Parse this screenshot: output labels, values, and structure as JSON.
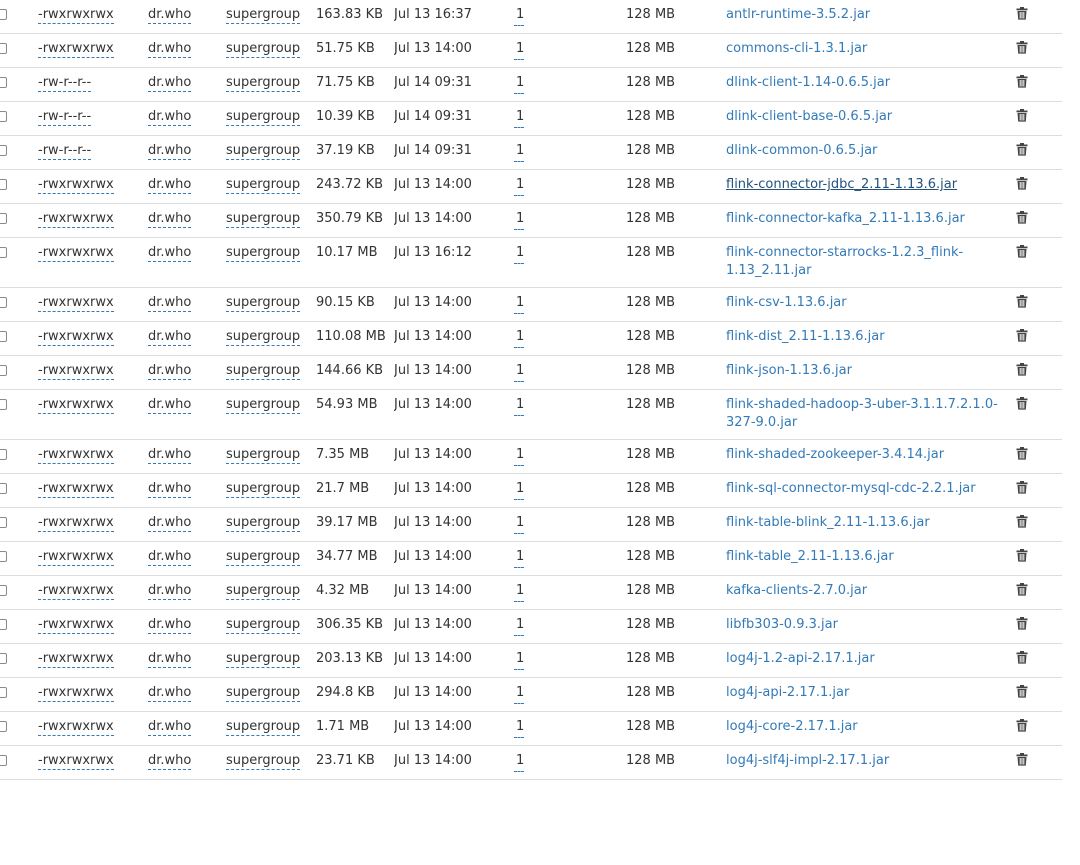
{
  "files": [
    {
      "permission": "-rwxrwxrwx",
      "owner": "dr.who",
      "group": "supergroup",
      "size": "163.83 KB",
      "last_modified": "Jul 13 16:37",
      "replication": "1",
      "block_size": "128 MB",
      "name": "antlr-runtime-3.5.2.jar"
    },
    {
      "permission": "-rwxrwxrwx",
      "owner": "dr.who",
      "group": "supergroup",
      "size": "51.75 KB",
      "last_modified": "Jul 13 14:00",
      "replication": "1",
      "block_size": "128 MB",
      "name": "commons-cli-1.3.1.jar"
    },
    {
      "permission": "-rw-r--r--",
      "owner": "dr.who",
      "group": "supergroup",
      "size": "71.75 KB",
      "last_modified": "Jul 14 09:31",
      "replication": "1",
      "block_size": "128 MB",
      "name": "dlink-client-1.14-0.6.5.jar"
    },
    {
      "permission": "-rw-r--r--",
      "owner": "dr.who",
      "group": "supergroup",
      "size": "10.39 KB",
      "last_modified": "Jul 14 09:31",
      "replication": "1",
      "block_size": "128 MB",
      "name": "dlink-client-base-0.6.5.jar"
    },
    {
      "permission": "-rw-r--r--",
      "owner": "dr.who",
      "group": "supergroup",
      "size": "37.19 KB",
      "last_modified": "Jul 14 09:31",
      "replication": "1",
      "block_size": "128 MB",
      "name": "dlink-common-0.6.5.jar"
    },
    {
      "permission": "-rwxrwxrwx",
      "owner": "dr.who",
      "group": "supergroup",
      "size": "243.72 KB",
      "last_modified": "Jul 13 14:00",
      "replication": "1",
      "block_size": "128 MB",
      "name": "flink-connector-jdbc_2.11-1.13.6.jar",
      "focused": true
    },
    {
      "permission": "-rwxrwxrwx",
      "owner": "dr.who",
      "group": "supergroup",
      "size": "350.79 KB",
      "last_modified": "Jul 13 14:00",
      "replication": "1",
      "block_size": "128 MB",
      "name": "flink-connector-kafka_2.11-1.13.6.jar"
    },
    {
      "permission": "-rwxrwxrwx",
      "owner": "dr.who",
      "group": "supergroup",
      "size": "10.17 MB",
      "last_modified": "Jul 13 16:12",
      "replication": "1",
      "block_size": "128 MB",
      "name": "flink-connector-starrocks-1.2.3_flink-1.13_2.11.jar"
    },
    {
      "permission": "-rwxrwxrwx",
      "owner": "dr.who",
      "group": "supergroup",
      "size": "90.15 KB",
      "last_modified": "Jul 13 14:00",
      "replication": "1",
      "block_size": "128 MB",
      "name": "flink-csv-1.13.6.jar"
    },
    {
      "permission": "-rwxrwxrwx",
      "owner": "dr.who",
      "group": "supergroup",
      "size": "110.08 MB",
      "last_modified": "Jul 13 14:00",
      "replication": "1",
      "block_size": "128 MB",
      "name": "flink-dist_2.11-1.13.6.jar"
    },
    {
      "permission": "-rwxrwxrwx",
      "owner": "dr.who",
      "group": "supergroup",
      "size": "144.66 KB",
      "last_modified": "Jul 13 14:00",
      "replication": "1",
      "block_size": "128 MB",
      "name": "flink-json-1.13.6.jar"
    },
    {
      "permission": "-rwxrwxrwx",
      "owner": "dr.who",
      "group": "supergroup",
      "size": "54.93 MB",
      "last_modified": "Jul 13 14:00",
      "replication": "1",
      "block_size": "128 MB",
      "name": "flink-shaded-hadoop-3-uber-3.1.1.7.2.1.0-327-9.0.jar"
    },
    {
      "permission": "-rwxrwxrwx",
      "owner": "dr.who",
      "group": "supergroup",
      "size": "7.35 MB",
      "last_modified": "Jul 13 14:00",
      "replication": "1",
      "block_size": "128 MB",
      "name": "flink-shaded-zookeeper-3.4.14.jar"
    },
    {
      "permission": "-rwxrwxrwx",
      "owner": "dr.who",
      "group": "supergroup",
      "size": "21.7 MB",
      "last_modified": "Jul 13 14:00",
      "replication": "1",
      "block_size": "128 MB",
      "name": "flink-sql-connector-mysql-cdc-2.2.1.jar"
    },
    {
      "permission": "-rwxrwxrwx",
      "owner": "dr.who",
      "group": "supergroup",
      "size": "39.17 MB",
      "last_modified": "Jul 13 14:00",
      "replication": "1",
      "block_size": "128 MB",
      "name": "flink-table-blink_2.11-1.13.6.jar"
    },
    {
      "permission": "-rwxrwxrwx",
      "owner": "dr.who",
      "group": "supergroup",
      "size": "34.77 MB",
      "last_modified": "Jul 13 14:00",
      "replication": "1",
      "block_size": "128 MB",
      "name": "flink-table_2.11-1.13.6.jar"
    },
    {
      "permission": "-rwxrwxrwx",
      "owner": "dr.who",
      "group": "supergroup",
      "size": "4.32 MB",
      "last_modified": "Jul 13 14:00",
      "replication": "1",
      "block_size": "128 MB",
      "name": "kafka-clients-2.7.0.jar"
    },
    {
      "permission": "-rwxrwxrwx",
      "owner": "dr.who",
      "group": "supergroup",
      "size": "306.35 KB",
      "last_modified": "Jul 13 14:00",
      "replication": "1",
      "block_size": "128 MB",
      "name": "libfb303-0.9.3.jar"
    },
    {
      "permission": "-rwxrwxrwx",
      "owner": "dr.who",
      "group": "supergroup",
      "size": "203.13 KB",
      "last_modified": "Jul 13 14:00",
      "replication": "1",
      "block_size": "128 MB",
      "name": "log4j-1.2-api-2.17.1.jar"
    },
    {
      "permission": "-rwxrwxrwx",
      "owner": "dr.who",
      "group": "supergroup",
      "size": "294.8 KB",
      "last_modified": "Jul 13 14:00",
      "replication": "1",
      "block_size": "128 MB",
      "name": "log4j-api-2.17.1.jar"
    },
    {
      "permission": "-rwxrwxrwx",
      "owner": "dr.who",
      "group": "supergroup",
      "size": "1.71 MB",
      "last_modified": "Jul 13 14:00",
      "replication": "1",
      "block_size": "128 MB",
      "name": "log4j-core-2.17.1.jar"
    },
    {
      "permission": "-rwxrwxrwx",
      "owner": "dr.who",
      "group": "supergroup",
      "size": "23.71 KB",
      "last_modified": "Jul 13 14:00",
      "replication": "1",
      "block_size": "128 MB",
      "name": "log4j-slf4j-impl-2.17.1.jar"
    }
  ],
  "icons": {
    "delete": "trash-icon",
    "select": "checkbox"
  },
  "colors": {
    "link": "#337ab7",
    "text": "#333333",
    "divider": "#dddddd"
  }
}
